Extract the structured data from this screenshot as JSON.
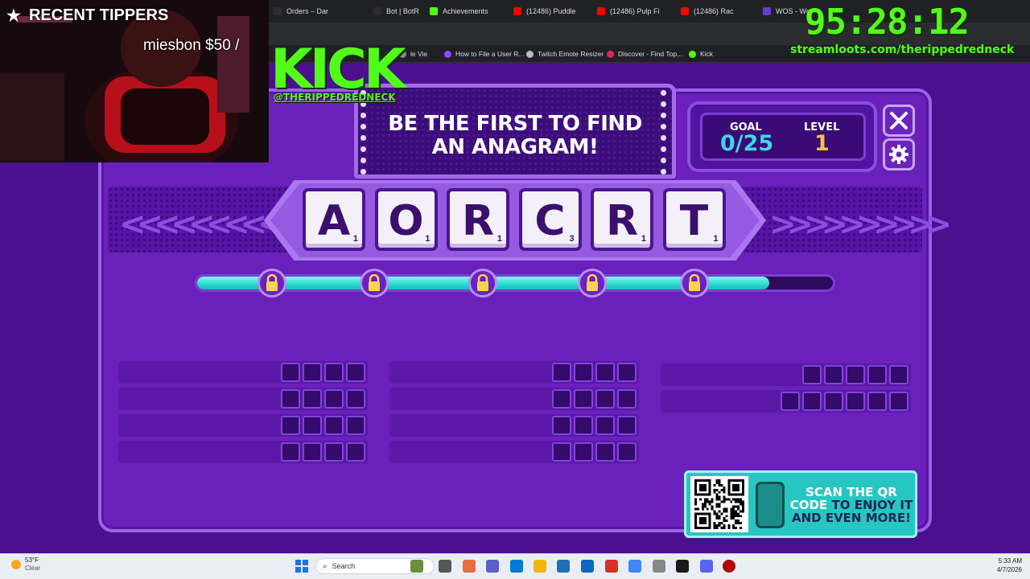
{
  "browser": {
    "tabs": [
      {
        "label": "Orders – Dar",
        "color": "#2d2d2d"
      },
      {
        "label": "Bot | BotR",
        "color": "#2d2d2d"
      },
      {
        "label": "Achievements",
        "color": "#53fc18"
      },
      {
        "label": "(12486) Puddle",
        "color": "#ff0000"
      },
      {
        "label": "(12486) Pulp Fi",
        "color": "#ff0000"
      },
      {
        "label": "(12486) Rac",
        "color": "#ff0000"
      },
      {
        "label": "WOS - Wor",
        "color": "#6a3bd2"
      }
    ],
    "bookmarks": [
      {
        "label": "le Vie",
        "color": "#888"
      },
      {
        "label": "How to File a User R...",
        "color": "#9146ff"
      },
      {
        "label": "Twitch Emote Resizer",
        "color": "#bbb"
      },
      {
        "label": "Discover - Find Top...",
        "color": "#e0245e"
      },
      {
        "label": "Kick",
        "color": "#53fc18"
      }
    ]
  },
  "overlay": {
    "recent_tippers_label": "RECENT TIPPERS",
    "tipper": "miesbon $50 /",
    "kick_logo": "KICK",
    "kick_handle": "@THERIPPEDREDNECK",
    "timer": "95:28:12",
    "streamloots_url": "streamloots.com/therippedredneck"
  },
  "game": {
    "instruction_line1": "BE THE FIRST TO FIND",
    "instruction_line2": "AN ANAGRAM!",
    "goal_label": "GOAL",
    "goal_value": "0/25",
    "level_label": "LEVEL",
    "level_value": "1",
    "close_icon": "close-icon",
    "settings_icon": "gear-icon",
    "tiles": [
      {
        "letter": "A",
        "points": "1"
      },
      {
        "letter": "O",
        "points": "1"
      },
      {
        "letter": "R",
        "points": "1"
      },
      {
        "letter": "C",
        "points": "3"
      },
      {
        "letter": "R",
        "points": "1"
      },
      {
        "letter": "T",
        "points": "1"
      }
    ],
    "progress_fraction": 0.9,
    "locks": 5,
    "word_rows": {
      "column1": [
        4,
        4,
        4,
        4
      ],
      "column2": [
        4,
        4,
        4,
        4
      ],
      "column3": [
        5,
        6
      ]
    },
    "qr_text_part1": "SCAN THE QR",
    "qr_text_part2": "CODE",
    "qr_text_part3": "TO ENJOY IT",
    "qr_text_part4": "AND EVEN MORE!",
    "colors": {
      "background": "#4a108f",
      "panel": "#6a20bb",
      "progress": "#29d9d2",
      "goal": "#3fd6e8",
      "level": "#f7c23a",
      "kick_green": "#53fc18",
      "qr_panel": "#28c6c2"
    }
  },
  "taskbar": {
    "weather_temp": "53°F",
    "weather_desc": "Clear",
    "search_placeholder": "Search",
    "time": "5:33 AM",
    "date": "4/7/2026"
  }
}
